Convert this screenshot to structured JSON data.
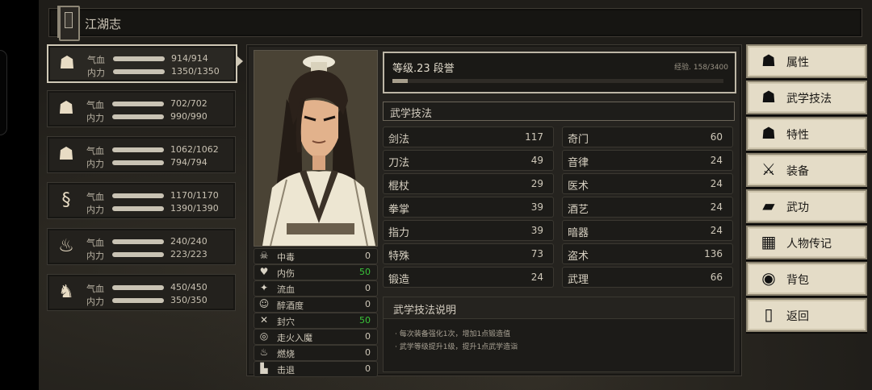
{
  "title": "江湖志",
  "party": [
    {
      "avatar_icon": "hero-avatar-icon",
      "glyph": "☗",
      "hp_label": "气血",
      "mp_label": "内力",
      "hp": "914/914",
      "mp": "1350/1350",
      "hp_pct": 100,
      "mp_pct": 100,
      "active": true
    },
    {
      "avatar_icon": "monk-avatar-icon",
      "glyph": "☗",
      "hp_label": "气血",
      "mp_label": "内力",
      "hp": "702/702",
      "mp": "990/990",
      "hp_pct": 100,
      "mp_pct": 100,
      "active": false
    },
    {
      "avatar_icon": "girl-avatar-icon",
      "glyph": "☗",
      "hp_label": "气血",
      "mp_label": "内力",
      "hp": "1062/1062",
      "mp": "794/794",
      "hp_pct": 100,
      "mp_pct": 100,
      "active": false
    },
    {
      "avatar_icon": "snake-avatar-icon",
      "glyph": "§",
      "hp_label": "气血",
      "mp_label": "内力",
      "hp": "1170/1170",
      "mp": "1390/1390",
      "hp_pct": 100,
      "mp_pct": 100,
      "active": false
    },
    {
      "avatar_icon": "goose-avatar-icon",
      "glyph": "♨",
      "hp_label": "气血",
      "mp_label": "内力",
      "hp": "240/240",
      "mp": "223/223",
      "hp_pct": 100,
      "mp_pct": 100,
      "active": false
    },
    {
      "avatar_icon": "fox-avatar-icon",
      "glyph": "♞",
      "hp_label": "气血",
      "mp_label": "内力",
      "hp": "450/450",
      "mp": "350/350",
      "hp_pct": 100,
      "mp_pct": 100,
      "active": false
    }
  ],
  "statuses": [
    {
      "icon": "skull-icon",
      "glyph": "☠",
      "label": "中毒",
      "value": "0",
      "green": false
    },
    {
      "icon": "broken-heart-icon",
      "glyph": "♥",
      "label": "内伤",
      "value": "50",
      "green": true
    },
    {
      "icon": "blood-drop-icon",
      "glyph": "✦",
      "label": "流血",
      "value": "0",
      "green": false
    },
    {
      "icon": "drunk-face-icon",
      "glyph": "☺",
      "label": "醉酒度",
      "value": "0",
      "green": false
    },
    {
      "icon": "pressure-point-icon",
      "glyph": "✕",
      "label": "封穴",
      "value": "50",
      "green": true
    },
    {
      "icon": "qi-deviation-icon",
      "glyph": "◎",
      "label": "走火入魔",
      "value": "0",
      "green": false
    },
    {
      "icon": "flame-icon",
      "glyph": "♨",
      "label": "燃烧",
      "value": "0",
      "green": false
    },
    {
      "icon": "knockback-icon",
      "glyph": "▙",
      "label": "击退",
      "value": "0",
      "green": false
    }
  ],
  "level": {
    "text": "等级.23 段誉",
    "exp": "经验. 158/3400",
    "exp_pct": 4.6
  },
  "skills_title": "武学技法",
  "skills": [
    {
      "name": "剑法",
      "value": "117"
    },
    {
      "name": "奇门",
      "value": "60"
    },
    {
      "name": "刀法",
      "value": "49"
    },
    {
      "name": "音律",
      "value": "24"
    },
    {
      "name": "棍杖",
      "value": "29"
    },
    {
      "name": "医术",
      "value": "24"
    },
    {
      "name": "拳掌",
      "value": "39"
    },
    {
      "name": "酒艺",
      "value": "24"
    },
    {
      "name": "指力",
      "value": "39"
    },
    {
      "name": "暗器",
      "value": "24"
    },
    {
      "name": "特殊",
      "value": "73"
    },
    {
      "name": "盗术",
      "value": "136"
    },
    {
      "name": "锻造",
      "value": "24"
    },
    {
      "name": "武理",
      "value": "66"
    }
  ],
  "description": {
    "title": "武学技法说明",
    "lines": [
      "· 每次装备强化1次，增加1点锻造值",
      "· 武学等级提升1级，提升1点武学造诣"
    ]
  },
  "menu": [
    {
      "icon": "person-icon",
      "glyph": "☗",
      "label": "属性"
    },
    {
      "icon": "martial-person-icon",
      "glyph": "☗",
      "label": "武学技法"
    },
    {
      "icon": "trait-person-icon",
      "glyph": "☗",
      "label": "特性"
    },
    {
      "icon": "sword-icon",
      "glyph": "⚔",
      "label": "装备"
    },
    {
      "icon": "manual-book-icon",
      "glyph": "▰",
      "label": "武功"
    },
    {
      "icon": "scroll-icon",
      "glyph": "▦",
      "label": "人物传记"
    },
    {
      "icon": "bag-icon",
      "glyph": "◉",
      "label": "背包"
    },
    {
      "icon": "door-icon",
      "glyph": "▯",
      "label": "返回"
    }
  ]
}
